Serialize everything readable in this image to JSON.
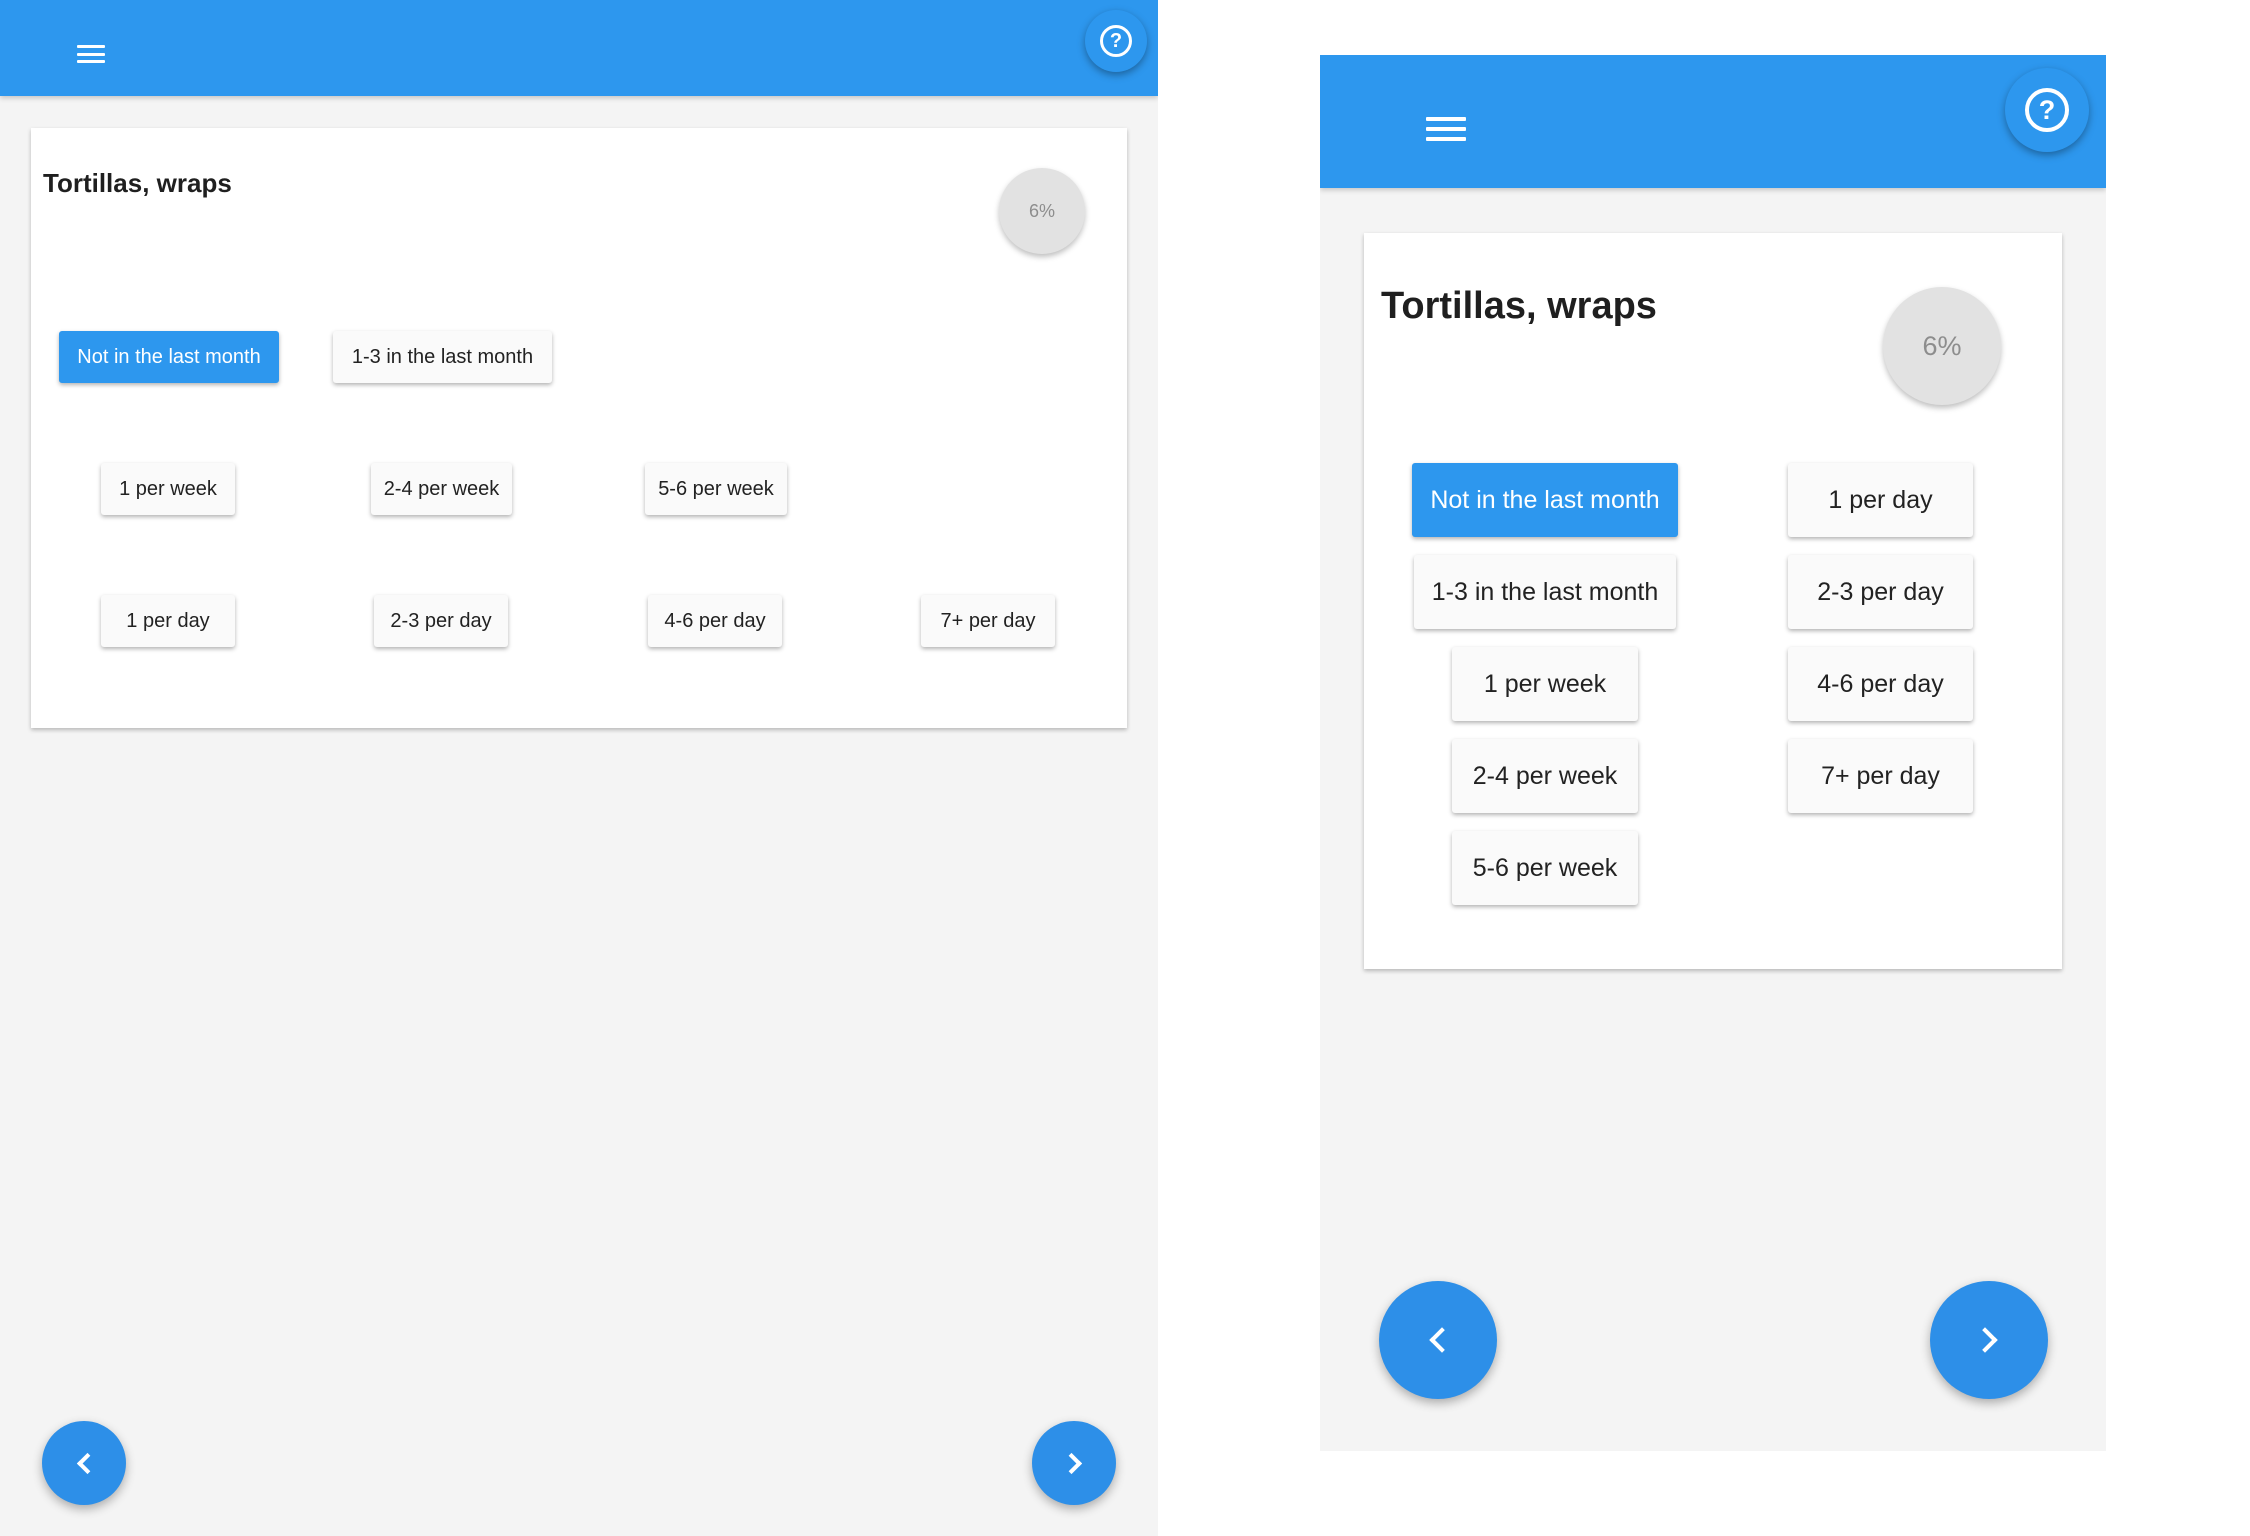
{
  "header": {
    "menu_icon": "menu-icon",
    "help_icon": "help-circle-icon",
    "help_glyph": "?"
  },
  "question": {
    "title": "Tortillas, wraps",
    "progress_label": "6%",
    "progress_fraction": 0.06
  },
  "options": [
    {
      "label": "Not in the last month",
      "selected": true
    },
    {
      "label": "1-3 in the last month",
      "selected": false
    },
    {
      "label": "1 per week",
      "selected": false
    },
    {
      "label": "2-4 per week",
      "selected": false
    },
    {
      "label": "5-6 per week",
      "selected": false
    },
    {
      "label": "1 per day",
      "selected": false
    },
    {
      "label": "2-3 per day",
      "selected": false
    },
    {
      "label": "4-6 per day",
      "selected": false
    },
    {
      "label": "7+ per day",
      "selected": false
    }
  ],
  "navigation": {
    "previous_icon": "chevron-left-icon",
    "next_icon": "chevron-right-icon"
  },
  "colors": {
    "accent": "#2d97ee",
    "fab": "#2d8fe8",
    "background": "#f4f4f4",
    "card": "#ffffff",
    "progress_circle": "#e2e2e2"
  }
}
